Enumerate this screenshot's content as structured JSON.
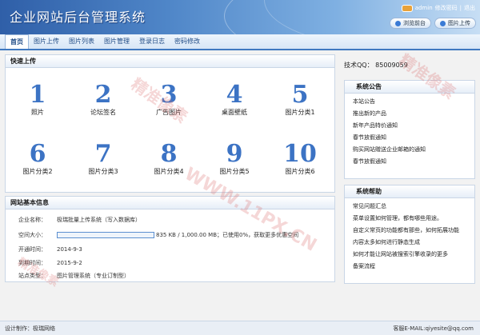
{
  "header": {
    "title": "企业网站后台管理系统",
    "user": "admin",
    "change_password": "修改密码",
    "logout": "退出",
    "buttons": [
      "浏览前台",
      "图片上传"
    ]
  },
  "tabs": [
    "首页",
    "图片上传",
    "图片列表",
    "图片管理",
    "登录日志",
    "密码修改"
  ],
  "quick_upload": {
    "title": "快速上传",
    "items": [
      {
        "num": "1",
        "label": "照片"
      },
      {
        "num": "2",
        "label": "论坛签名"
      },
      {
        "num": "3",
        "label": "广告图片"
      },
      {
        "num": "4",
        "label": "桌面壁纸"
      },
      {
        "num": "5",
        "label": "图片分类1"
      },
      {
        "num": "6",
        "label": "图片分类2"
      },
      {
        "num": "7",
        "label": "图片分类3"
      },
      {
        "num": "8",
        "label": "图片分类4"
      },
      {
        "num": "9",
        "label": "图片分类5"
      },
      {
        "num": "10",
        "label": "图片分类6"
      }
    ]
  },
  "site_info": {
    "title": "网站基本信息",
    "rows": {
      "company": {
        "key": "企业名称：",
        "value": "极瑞批量上传系统（写入数据库）"
      },
      "space": {
        "key": "空间大小：",
        "size": "835 KB / 1,000.00 MB；",
        "used": "已使用0%",
        "more": "，获取更多优惠空间",
        "used_fraction": 0
      },
      "open": {
        "key": "开通时间：",
        "value": "2014-9-3"
      },
      "expire": {
        "key": "到期时间：",
        "value": "2015-9-2"
      },
      "type": {
        "key": "站点类型：",
        "value": "图片管理系统（专业订制型）"
      }
    }
  },
  "qq": "技术QQ：  85009059",
  "notice": {
    "title": "系统公告",
    "items": [
      "本站公告",
      "推出新的产品",
      "新年产品特价通知",
      "春节放假通知",
      "购买网站赠送企业邮箱的通知",
      "春节放假通知"
    ]
  },
  "help": {
    "title": "系统帮助",
    "items": [
      "常见问题汇总",
      "菜单设置如何管理，都有哪些用途。",
      "自定义常页的功能都有那些，如何拓展功能",
      "内容太多如何进行静态生成",
      "如何才能让网站被搜索引擎收录的更多",
      "备案流程"
    ]
  },
  "footer": {
    "left": "设计制作：极瑞网络",
    "right": "客服E-MAIL:qiyesite@qq.com"
  },
  "watermark": [
    "精准像素",
    "WWW.11PX.CN",
    "精准像素",
    "精准像素"
  ]
}
